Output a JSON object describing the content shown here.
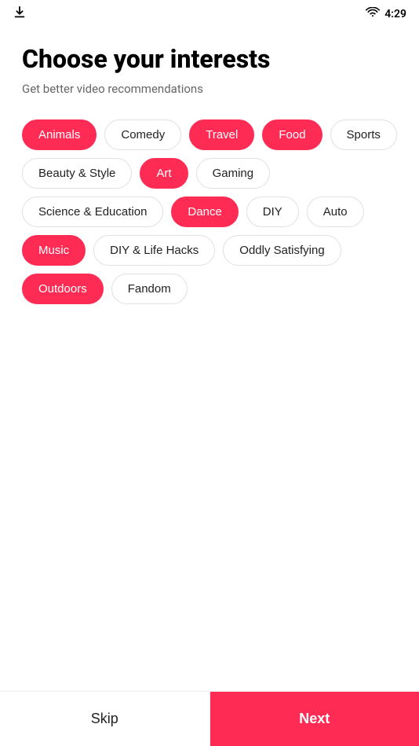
{
  "statusBar": {
    "time": "4:29"
  },
  "page": {
    "title": "Choose your interests",
    "subtitle": "Get better video recommendations"
  },
  "tags": [
    {
      "id": "animals",
      "label": "Animals",
      "selected": true
    },
    {
      "id": "comedy",
      "label": "Comedy",
      "selected": false
    },
    {
      "id": "travel",
      "label": "Travel",
      "selected": true
    },
    {
      "id": "food",
      "label": "Food",
      "selected": true
    },
    {
      "id": "sports",
      "label": "Sports",
      "selected": false
    },
    {
      "id": "beauty-style",
      "label": "Beauty & Style",
      "selected": false
    },
    {
      "id": "art",
      "label": "Art",
      "selected": true
    },
    {
      "id": "gaming",
      "label": "Gaming",
      "selected": false
    },
    {
      "id": "science-education",
      "label": "Science & Education",
      "selected": false
    },
    {
      "id": "dance",
      "label": "Dance",
      "selected": true
    },
    {
      "id": "diy",
      "label": "DIY",
      "selected": false
    },
    {
      "id": "auto",
      "label": "Auto",
      "selected": false
    },
    {
      "id": "music",
      "label": "Music",
      "selected": true
    },
    {
      "id": "diy-life-hacks",
      "label": "DIY & Life Hacks",
      "selected": false
    },
    {
      "id": "oddly-satisfying",
      "label": "Oddly Satisfying",
      "selected": false
    },
    {
      "id": "outdoors",
      "label": "Outdoors",
      "selected": true
    },
    {
      "id": "fandom",
      "label": "Fandom",
      "selected": false
    }
  ],
  "buttons": {
    "skip": "Skip",
    "next": "Next"
  },
  "colors": {
    "accent": "#fe2c55"
  }
}
